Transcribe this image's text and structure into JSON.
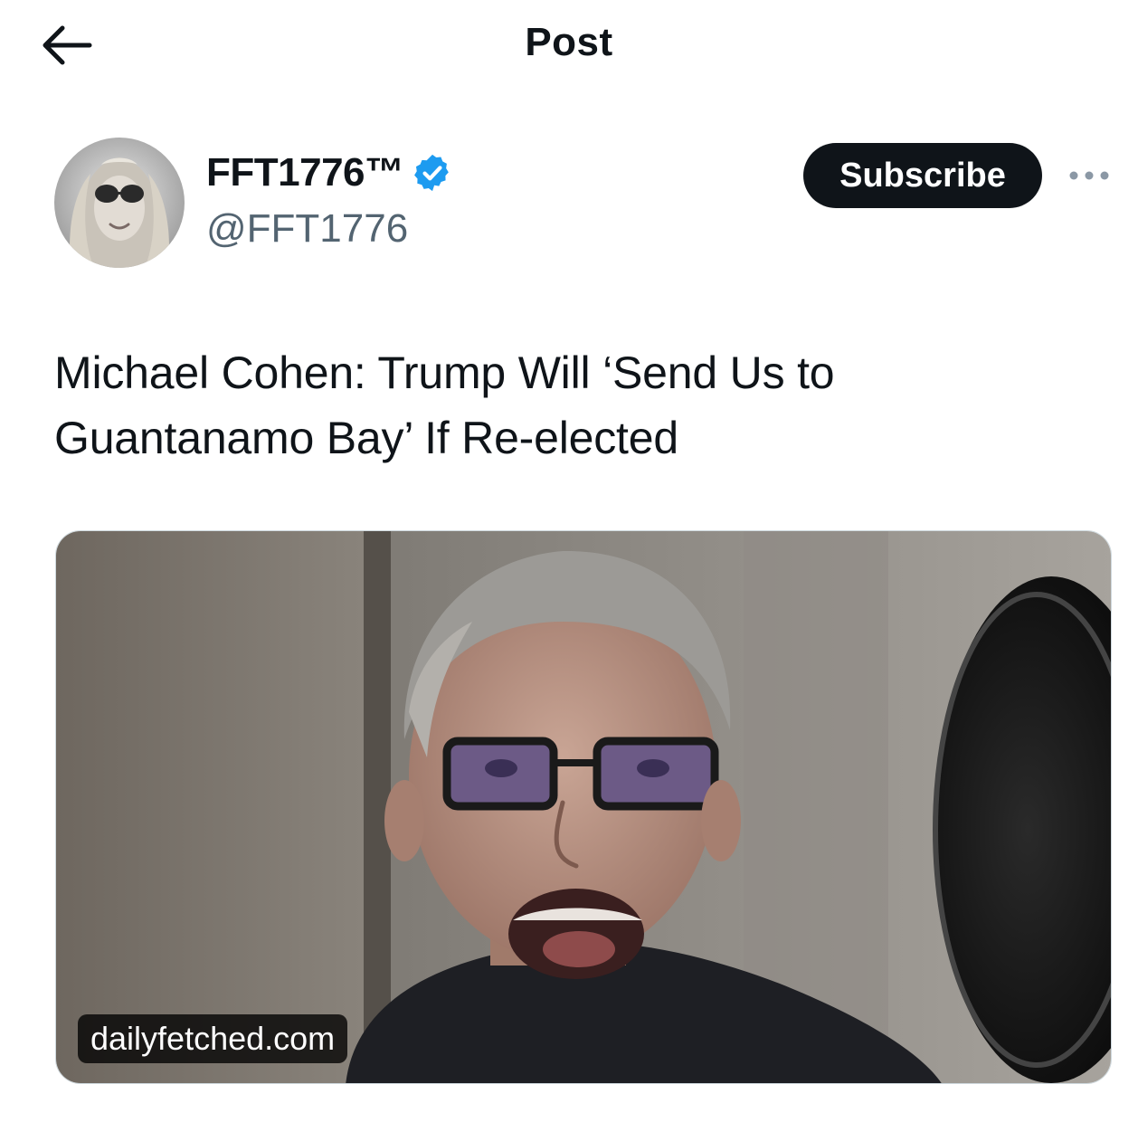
{
  "header": {
    "title": "Post",
    "back_icon": "arrow-left-icon"
  },
  "author": {
    "display_name": "FFT1776™",
    "handle": "@FFT1776",
    "verified": true,
    "verified_color": "#1d9bf0",
    "avatar_signature": "Sheri"
  },
  "actions": {
    "subscribe_label": "Subscribe",
    "more_icon": "more-horizontal-icon"
  },
  "post": {
    "text": "Michael Cohen: Trump Will ‘Send Us to Guantanamo Bay’ If Re-elected"
  },
  "media": {
    "type": "link-card-image",
    "domain": "dailyfetched.com"
  },
  "colors": {
    "text_primary": "#0f1419",
    "text_secondary": "#536471",
    "button_bg": "#0f1419",
    "button_text": "#ffffff"
  }
}
